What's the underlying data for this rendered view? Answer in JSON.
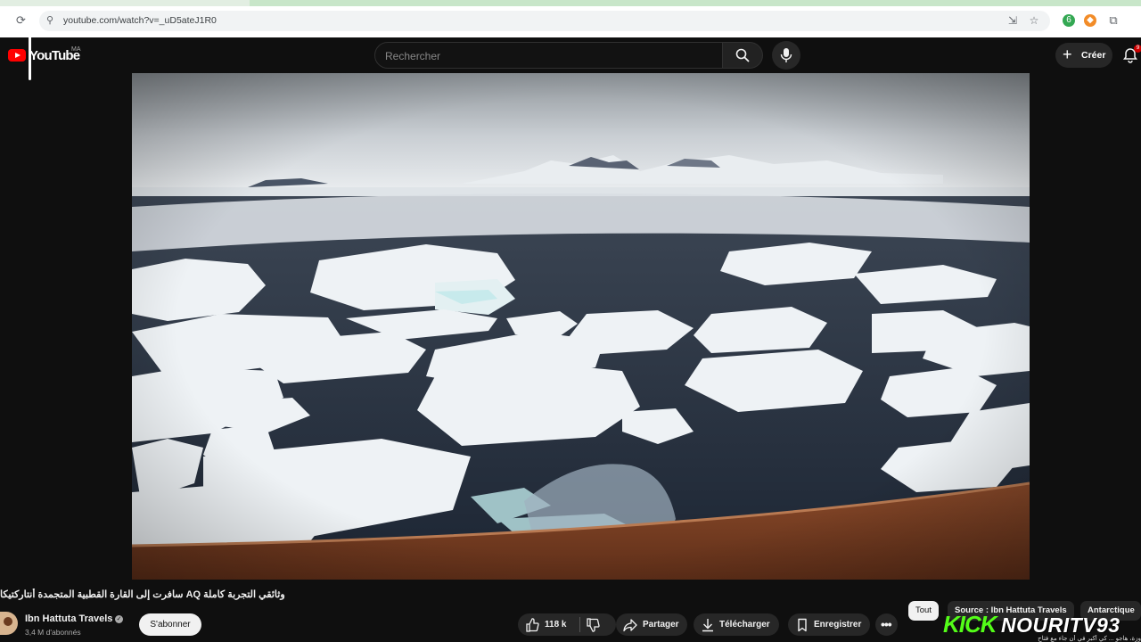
{
  "browser": {
    "url": "youtube.com/watch?v=_uD5ateJ1R0",
    "icons": [
      "reload-icon",
      "site-info-icon",
      "install-icon",
      "bookmark-star-icon",
      "extension-badge-icon",
      "extension-avatar-icon",
      "extensions-puzzle-icon"
    ],
    "extension_badge_count": "6"
  },
  "header": {
    "logo_text": "YouTube",
    "country_code": "MA",
    "search_placeholder": "Rechercher",
    "create_label": "Créer",
    "notification_count": "9"
  },
  "video": {
    "scene": "antarctic-sea-ice",
    "title": "وثائقي التجربة كاملة AQ سافرت إلى القارة القطبية المتجمدة أنتاركتيكا"
  },
  "channel": {
    "name": "Ibn Hattuta Travels",
    "subscribers": "3,4 M d'abonnés",
    "subscribe_label": "S'abonner"
  },
  "actions": {
    "likes": "118 k",
    "share_label": "Partager",
    "download_label": "Télécharger",
    "save_label": "Enregistrer"
  },
  "chips": [
    "Tout",
    "Source : Ibn Hattuta Travels",
    "Antarctique"
  ],
  "overlay": {
    "platform": "KICK",
    "handle": "NOURITV93",
    "ticker": "وزة، هاجو ... كي أكبر في أن جاء مع فتاح"
  },
  "colors": {
    "background": "#0f0f0f",
    "logo_red": "#ff0000",
    "kick_green": "#53fc18",
    "pill_bg": "#272727"
  }
}
